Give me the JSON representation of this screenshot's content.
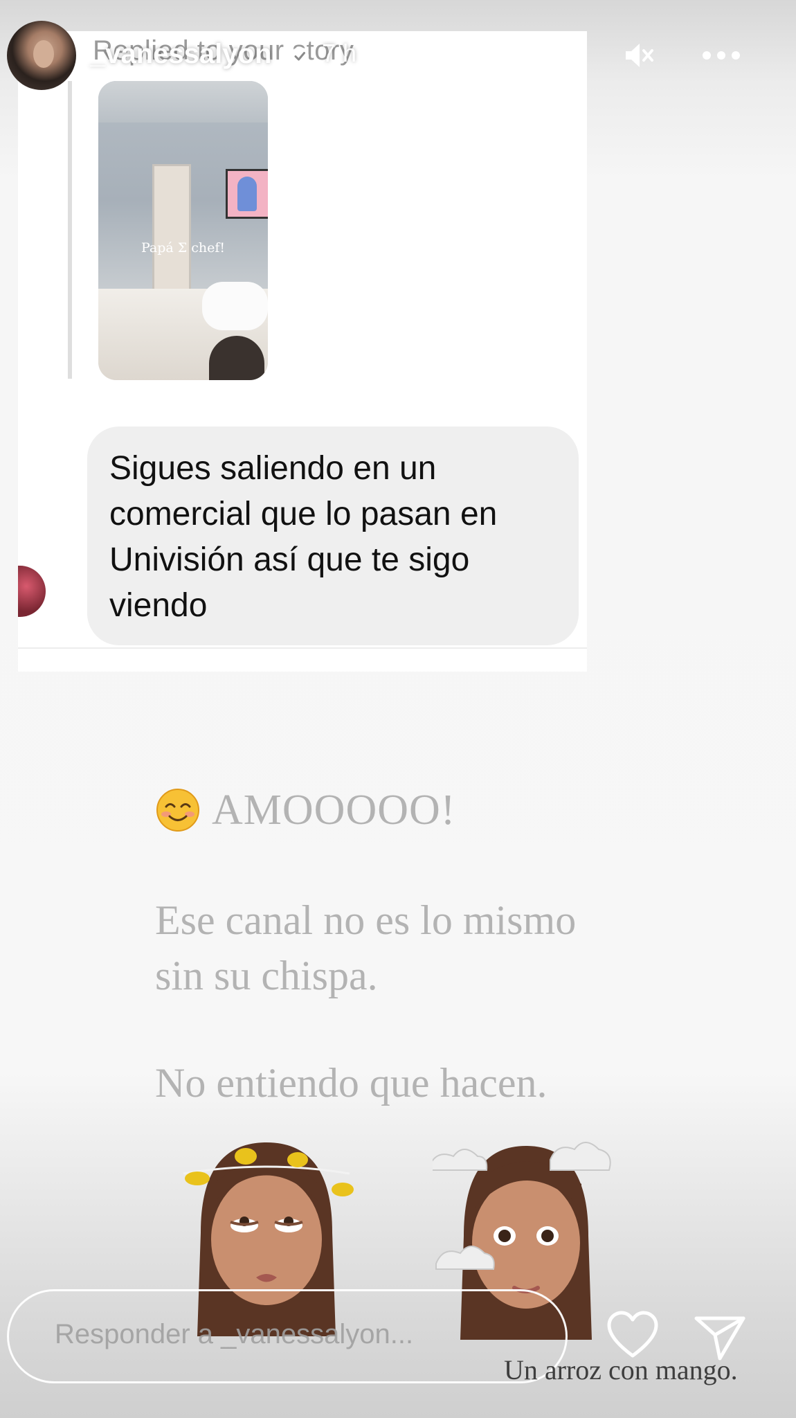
{
  "header": {
    "username": "_vanessalyon",
    "time": "7 h",
    "icons": [
      "play-icon",
      "mute-icon",
      "more-icon",
      "verified-badge-icon"
    ]
  },
  "embedded_dm": {
    "replied_label": "Replied to your story",
    "thumbnail_caption": "Papá Σ chef!",
    "message": "Sigues saliendo en un comercial que lo pasan en Univisión así que te sigo viendo"
  },
  "story": {
    "emoji": "😊",
    "line_amo": "AMOOOOO!",
    "line_canal_1": "Ese canal no es lo mismo",
    "line_canal_2": "sin su chispa.",
    "line_entiendo": "No entiendo que hacen.",
    "caption_bottom": "Un arroz con mango."
  },
  "reply_bar": {
    "placeholder": "Responder a _vanessalyon..."
  },
  "colors": {
    "story_text": "#b3b3b3",
    "bubble": "#efefef",
    "header_text": "#ffffff"
  }
}
